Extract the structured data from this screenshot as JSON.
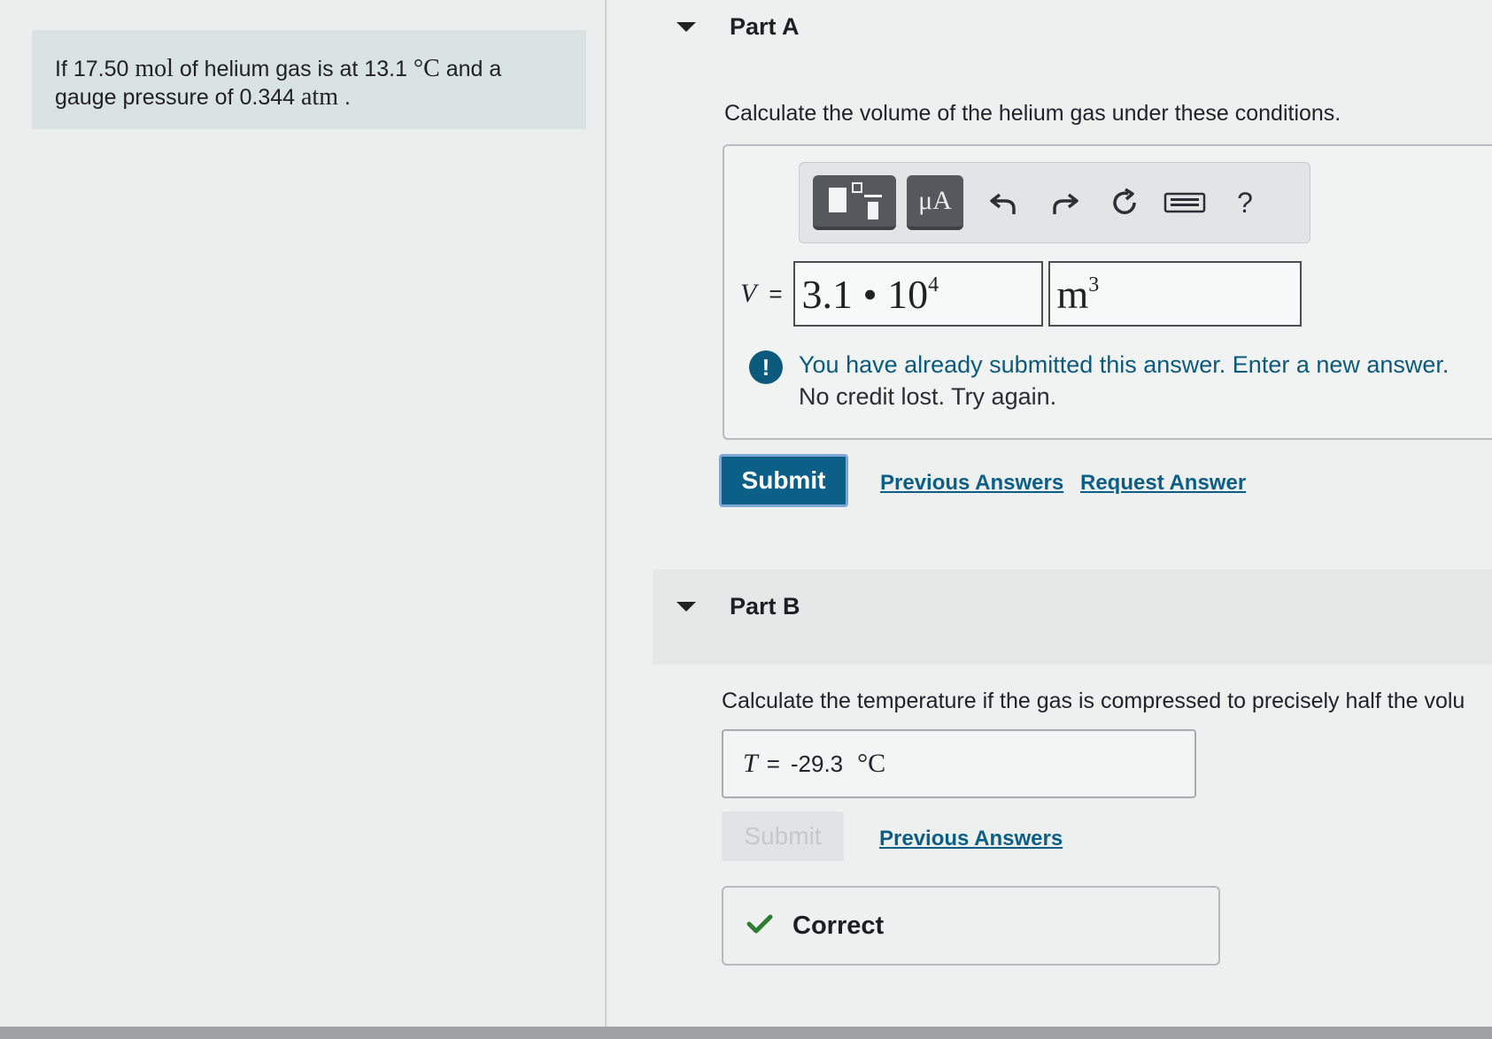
{
  "problem": {
    "text_before_mol": "If 17.50",
    "mol_unit": "mol",
    "text_after_mol": "of helium gas is at 13.1",
    "temp_unit": "°C",
    "text_and": "and a",
    "text_gauge": "gauge pressure of 0.344",
    "pressure_unit": "atm",
    "end": "."
  },
  "partA": {
    "label": "Part A",
    "question": "Calculate the volume of the helium gas under these conditions.",
    "toolbar": {
      "mu_label": "μA",
      "help_label": "?"
    },
    "variable": "V",
    "equals": "=",
    "value_mantissa": "3.1 • 10",
    "value_exponent": "4",
    "unit_base": "m",
    "unit_exponent": "3",
    "alert_line1": "You have already submitted this answer. Enter a new answer.",
    "alert_line2": "No credit lost. Try again.",
    "alert_icon": "!",
    "submit": "Submit",
    "previous_answers": "Previous Answers",
    "request_answer": "Request Answer"
  },
  "partB": {
    "label": "Part B",
    "question": "Calculate the temperature if the gas is compressed to precisely half the volu",
    "variable": "T",
    "equals": "=",
    "value": "-29.3",
    "unit": "°C",
    "submit": "Submit",
    "previous_answers": "Previous Answers",
    "result": "Correct"
  },
  "colors": {
    "accent": "#0c5f86",
    "success": "#2e7d32",
    "problem_bg": "#d9e3e2"
  }
}
